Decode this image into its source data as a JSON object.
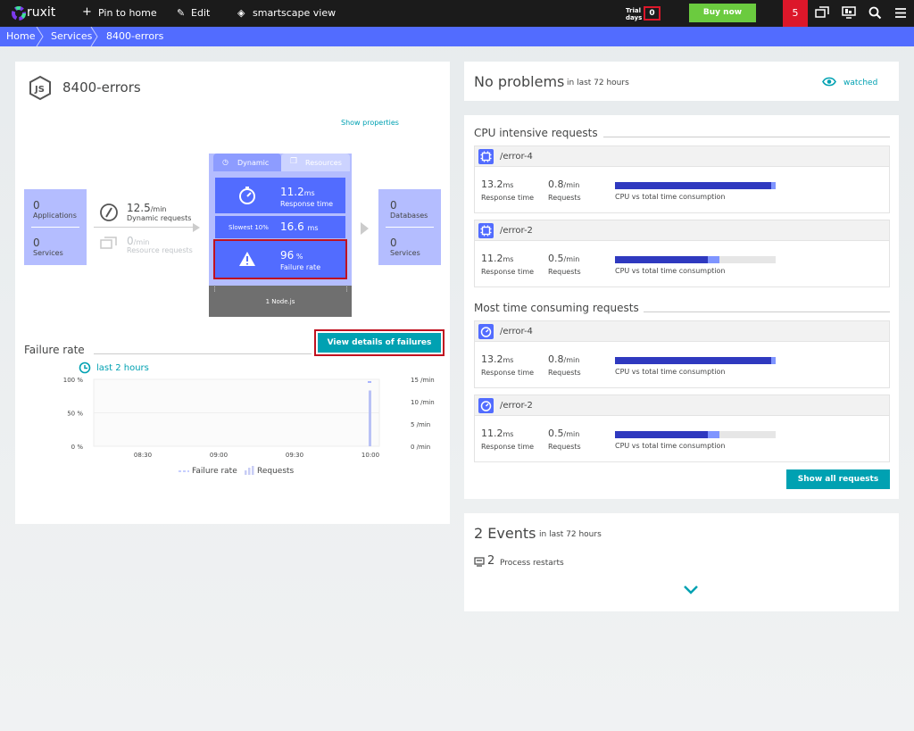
{
  "topbar": {
    "brand": "ruxit",
    "pin": "Pin to home",
    "edit": "Edit",
    "smartscape": "smartscape view",
    "trial_label_1": "Trial",
    "trial_label_2": "days",
    "trial_days": "0",
    "buy": "Buy now",
    "notifications": "5"
  },
  "breadcrumb": [
    "Home",
    "Services",
    "8400-errors"
  ],
  "service": {
    "title": "8400-errors",
    "show_properties": "Show properties"
  },
  "flow": {
    "left": {
      "apps_count": "0",
      "apps_label": "Applications",
      "services_count": "0",
      "services_label": "Services"
    },
    "dynamic_rate": "12.5",
    "dynamic_unit": "/min",
    "dynamic_label": "Dynamic requests",
    "resource_rate": "0",
    "resource_unit": "/min",
    "resource_label": "Resource requests",
    "tabs": {
      "dynamic": "Dynamic",
      "resources": "Resources"
    },
    "response_value": "11.2",
    "response_unit": "ms",
    "response_label": "Response time",
    "slowest_label": "Slowest 10%",
    "slowest_value": "16.6",
    "slowest_unit": "ms",
    "failure_value": "96",
    "failure_unit": "%",
    "failure_label": "Failure rate",
    "node_label": "1 Node.js",
    "right": {
      "db_count": "0",
      "db_label": "Databases",
      "services_count": "0",
      "services_label": "Services"
    }
  },
  "view_failures": "View details of failures",
  "failure_chart": {
    "title": "Failure rate",
    "range": "last 2 hours",
    "legend_failure": "Failure rate",
    "legend_requests": "Requests"
  },
  "chart_data": {
    "type": "bar",
    "x": [
      "08:30",
      "09:00",
      "09:30",
      "10:00"
    ],
    "y_left_ticks": [
      "100 %",
      "50 %",
      "0 %"
    ],
    "y_right_ticks": [
      "15 /min",
      "10 /min",
      "5 /min",
      "0 /min"
    ],
    "series": [
      {
        "name": "Requests",
        "values": [
          0,
          0,
          0,
          12.5
        ]
      },
      {
        "name": "Failure rate",
        "values": [
          0,
          0,
          0,
          96
        ]
      }
    ]
  },
  "problems": {
    "title": "No problems",
    "range": "in last 72 hours",
    "watched": "watched"
  },
  "cpu": {
    "title": "CPU intensive requests",
    "items": [
      {
        "name": "/error-4",
        "rt": "13.2",
        "rt_unit": "ms",
        "rt_label": "Response time",
        "req": "0.8",
        "req_unit": "/min",
        "req_label": "Requests",
        "bar_label": "CPU vs total time consumption",
        "cpu_share": 0.97,
        "total_share": 1.0
      },
      {
        "name": "/error-2",
        "rt": "11.2",
        "rt_unit": "ms",
        "rt_label": "Response time",
        "req": "0.5",
        "req_unit": "/min",
        "req_label": "Requests",
        "bar_label": "CPU vs total time consumption",
        "cpu_share": 0.58,
        "total_share": 0.65
      }
    ]
  },
  "time": {
    "title": "Most time consuming requests",
    "items": [
      {
        "name": "/error-4",
        "rt": "13.2",
        "rt_unit": "ms",
        "rt_label": "Response time",
        "req": "0.8",
        "req_unit": "/min",
        "req_label": "Requests",
        "bar_label": "CPU vs total time consumption",
        "cpu_share": 0.97,
        "total_share": 1.0
      },
      {
        "name": "/error-2",
        "rt": "11.2",
        "rt_unit": "ms",
        "rt_label": "Response time",
        "req": "0.5",
        "req_unit": "/min",
        "req_label": "Requests",
        "bar_label": "CPU vs total time consumption",
        "cpu_share": 0.58,
        "total_share": 0.65
      }
    ]
  },
  "show_all": "Show all requests",
  "events": {
    "count": "2",
    "title_word": "Events",
    "range": "in last 72 hours",
    "restart_count": "2",
    "restart_label": "Process restarts"
  }
}
